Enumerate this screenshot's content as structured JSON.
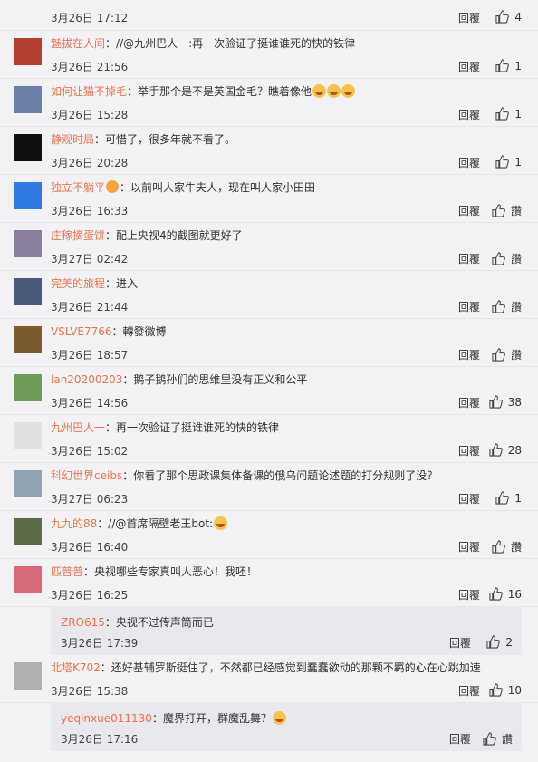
{
  "top": {
    "text": "...",
    "date": "3月26日 17:12",
    "reply": "回覆",
    "likes": "4"
  },
  "comments": [
    {
      "user": "魅拔在人间",
      "text": "：//@九州巴人一:再一次验证了挺谁谁死的快的铁律",
      "date": "3月26日 21:56",
      "reply": "回覆",
      "likes": "1",
      "avatar": "#b3402e"
    },
    {
      "user": "如何让猫不掉毛",
      "text": "：举手那个是不是英国金毛？瞧着像他",
      "date": "3月26日 15:28",
      "reply": "回覆",
      "likes": "1",
      "avatar": "#6b7fa8",
      "emojis": 3
    },
    {
      "user": "静观时局",
      "text": "：可惜了，很多年就不看了。",
      "date": "3月26日 20:28",
      "reply": "回覆",
      "likes": "1",
      "avatar": "#111111"
    },
    {
      "user": "独立不躺平",
      "text": "：以前叫人家牛夫人，现在叫人家小田田",
      "date": "3月26日 16:33",
      "reply": "回覆",
      "likes": "讚",
      "avatar": "#2f7ae5",
      "badge": true
    },
    {
      "user": "庄稼摘蛋饼",
      "text": "：配上央视4的截图就更好了",
      "date": "3月27日 02:42",
      "reply": "回覆",
      "likes": "讚",
      "avatar": "#8a7f9a"
    },
    {
      "user": "完美的旅程",
      "text": "：进入",
      "date": "3月26日 21:44",
      "reply": "回覆",
      "likes": "讚",
      "avatar": "#4a5a78"
    },
    {
      "user": "VSLVE7766",
      "text": "：轉發微博",
      "date": "3月26日 18:57",
      "reply": "回覆",
      "likes": "讚",
      "avatar": "#7a5b2e"
    },
    {
      "user": "lan20200203",
      "text": "：鹅子鹅孙们的思维里没有正义和公平",
      "date": "3月26日 14:56",
      "reply": "回覆",
      "likes": "38",
      "avatar": "#6e9a5a"
    },
    {
      "user": "九州巴人一",
      "text": "：再一次验证了挺谁谁死的快的铁律",
      "date": "3月26日 15:02",
      "reply": "回覆",
      "likes": "28",
      "avatar": "#e0e0e0"
    },
    {
      "user": "科幻世界ceibs",
      "text": "：你看了那个思政课集体备课的俄乌问题论述题的打分规则了没？",
      "date": "3月27日 06:23",
      "reply": "回覆",
      "likes": "1",
      "avatar": "#8fa3b0"
    },
    {
      "user": "九九的88",
      "text": "：//@首席隔壁老王bot:",
      "date": "3月26日 16:40",
      "reply": "回覆",
      "likes": "讚",
      "avatar": "#5c6b4a",
      "emojis": 1
    },
    {
      "user": "匹普普",
      "text": "：央视哪些专家真叫人恶心！我呸！",
      "date": "3月26日 16:25",
      "reply": "回覆",
      "likes": "16",
      "avatar": "#d66a7a"
    }
  ],
  "sub1": {
    "user": "ZRO615",
    "text": "：央视不过传声筒而已",
    "date": "3月26日 17:39",
    "reply": "回覆",
    "likes": "2"
  },
  "last": {
    "user": "北塔K702",
    "text": "：还好基辅罗斯挺住了，不然都已经感觉到蠢蠢欲动的那颗不羁的心在心跳加速",
    "date": "3月26日 15:38",
    "reply": "回覆",
    "likes": "10",
    "avatar": "#b0b0b0"
  },
  "sub2": {
    "user": "yeqinxue011130",
    "text": "：魔界打开，群魔乱舞？",
    "date": "3月26日 17:16",
    "reply": "回覆",
    "likes": "讚",
    "emojis": 1
  }
}
